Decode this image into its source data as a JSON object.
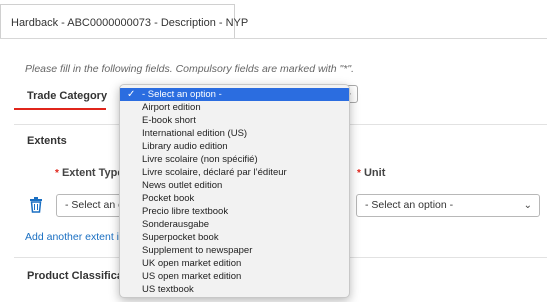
{
  "tab": {
    "label": "Hardback - ABC0000000073 - Description - NYP"
  },
  "form": {
    "hint": "Please fill in the following fields. Compulsory fields are marked with \"*\".",
    "trade_category_label": "Trade Category",
    "extents_label": "Extents",
    "required_marker": "*",
    "extent_type_label": "Extent Type",
    "unit_label": "Unit",
    "extent_type_select": "- Select an o",
    "unit_select": "- Select an option -",
    "add_extent_link": "Add another extent ite",
    "product_classification_label": "Product Classificatio"
  },
  "dropdown": {
    "options": [
      "- Select an option -",
      "Airport edition",
      "E-book short",
      "International edition (US)",
      "Library audio edition",
      "Livre scolaire (non spécifié)",
      "Livre scolaire, déclaré par l’éditeur",
      "News outlet edition",
      "Pocket book",
      "Precio libre textbook",
      "Sonderausgabe",
      "Superpocket book",
      "Supplement to newspaper",
      "UK open market edition",
      "US open market edition",
      "US textbook"
    ],
    "selected_index": 0,
    "check_glyph": "✓"
  },
  "icons": {
    "trash": "trash-icon",
    "chevron": "chevron-down-icon"
  },
  "colors": {
    "accent": "#e0251b",
    "link": "#1a6fc2",
    "highlight": "#2b6de0"
  }
}
